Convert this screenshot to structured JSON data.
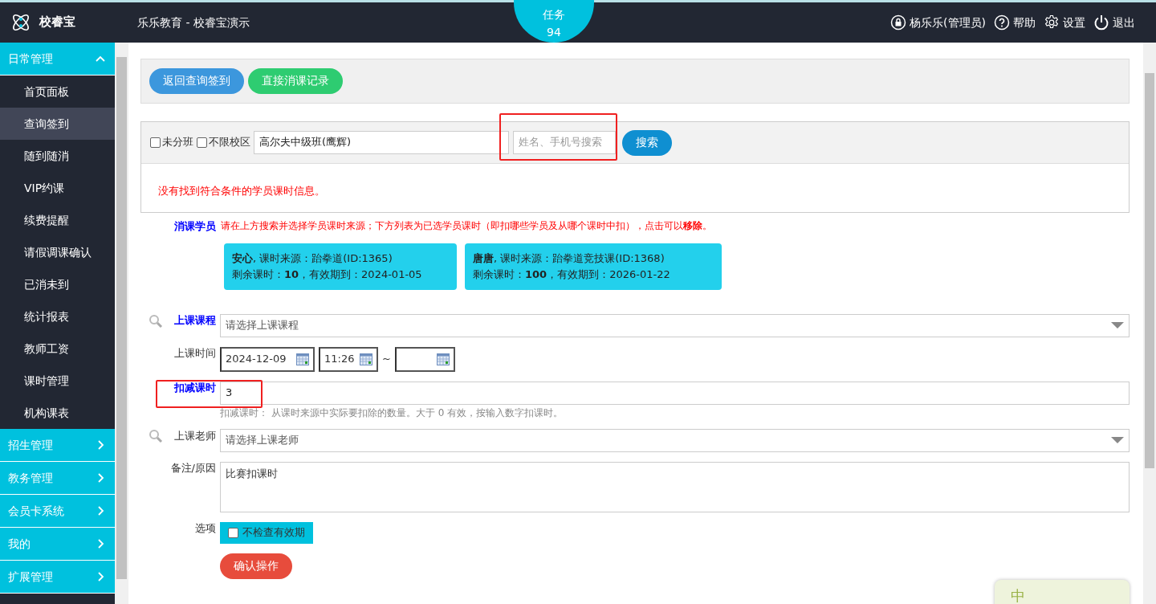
{
  "header": {
    "logo": "校睿宝",
    "org": "乐乐教育 - 校睿宝演示",
    "task": {
      "label": "任务",
      "count": "94"
    },
    "user": "杨乐乐(管理员)",
    "actions": [
      {
        "kind": "help",
        "label": "帮助"
      },
      {
        "kind": "settings",
        "label": "设置"
      },
      {
        "kind": "logout",
        "label": "退出"
      }
    ]
  },
  "sidebar": {
    "groups": [
      {
        "label": "日常管理",
        "expanded": true,
        "children": [
          {
            "label": "首页面板",
            "selected": false
          },
          {
            "label": "查询签到",
            "selected": true
          },
          {
            "label": "随到随消",
            "selected": false
          },
          {
            "label": "VIP约课",
            "selected": false
          },
          {
            "label": "续费提醒",
            "selected": false
          },
          {
            "label": "请假调课确认",
            "selected": false
          },
          {
            "label": "已消未到",
            "selected": false
          },
          {
            "label": "统计报表",
            "selected": false
          },
          {
            "label": "教师工资",
            "selected": false
          },
          {
            "label": "课时管理",
            "selected": false
          },
          {
            "label": "机构课表",
            "selected": false
          }
        ]
      },
      {
        "label": "招生管理",
        "expanded": false
      },
      {
        "label": "教务管理",
        "expanded": false
      },
      {
        "label": "会员卡系统",
        "expanded": false
      },
      {
        "label": "我的",
        "expanded": false
      },
      {
        "label": "扩展管理",
        "expanded": false
      }
    ]
  },
  "toolbar": {
    "buttons": [
      {
        "label": "返回查询签到",
        "kind": "primary"
      },
      {
        "label": "直接消课记录",
        "kind": "success"
      }
    ]
  },
  "filter": {
    "checkboxes": [
      {
        "label": "未分班",
        "checked": false
      },
      {
        "label": "不限校区",
        "checked": false
      }
    ],
    "class_field": {
      "value": "高尔夫中级班(鹰辉)"
    },
    "search_field": {
      "placeholder": "姓名、手机号搜索",
      "highlighted": true
    },
    "search_button": "搜索",
    "message": "没有找到符合条件的学员课时信息。"
  },
  "students": {
    "label": "消课学员",
    "hint": "请在上方搜索并选择学员课时来源；下方列表为已选学员课时（即扣哪些学员及从哪个课时中扣），点击可以**移除**。",
    "cards": [
      {
        "lines": [
          "**安心**, 课时来源：跆拳道(ID:1365)",
          "剩余课时：**10**，有效期到：2024-01-05"
        ]
      },
      {
        "lines": [
          "**唐唐**, 课时来源：跆拳道竞技课(ID:1368)",
          "剩余课时：**100**，有效期到：2026-01-22"
        ]
      }
    ]
  },
  "form": {
    "fields": [
      {
        "kind": "select",
        "label": "上课课程",
        "emphasized": true,
        "searchable": true,
        "placeholder": "请选择上课课程"
      },
      {
        "kind": "datetime",
        "label": "上课时间",
        "emphasized": false,
        "searchable": false,
        "date": "2024-12-09",
        "time": "11:26",
        "separator": "~"
      },
      {
        "kind": "number",
        "label": "扣减课时",
        "emphasized": true,
        "searchable": false,
        "value": "3",
        "highlighted": true,
        "help": "扣减课时： 从课时来源中实际要扣除的数量。大于 0 有效，按输入数字扣课时。"
      },
      {
        "kind": "select",
        "label": "上课老师",
        "emphasized": false,
        "searchable": true,
        "placeholder": "请选择上课老师"
      },
      {
        "kind": "textarea",
        "label": "备注/原因",
        "emphasized": false,
        "searchable": false,
        "value": "比赛扣课时"
      },
      {
        "kind": "option",
        "label": "选项",
        "emphasized": false,
        "searchable": false,
        "option": "不检查有效期",
        "checked": false
      }
    ],
    "submit": "确认操作"
  },
  "widget": {
    "text": "中"
  }
}
